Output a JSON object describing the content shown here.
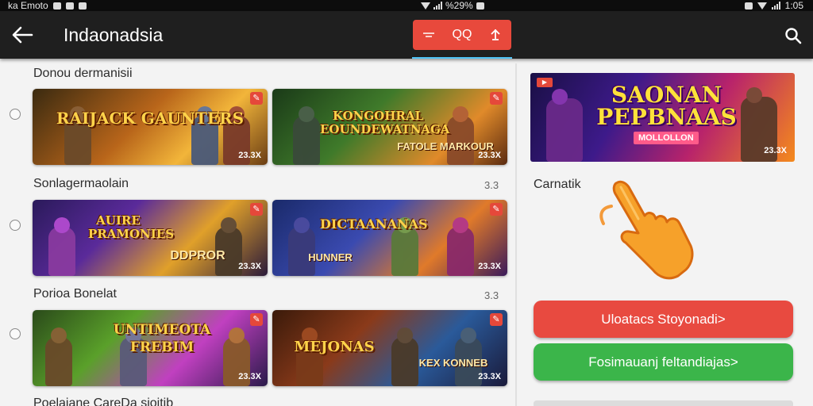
{
  "status_bar": {
    "left_text": "ka Emoto",
    "center_text": "%29%",
    "time": "1:05"
  },
  "app_bar": {
    "title": "Indaonadsia",
    "segment_label": "QQ"
  },
  "sections": [
    {
      "label": "Donou dermanisii",
      "count": "",
      "cards": [
        {
          "title": "RAIJACK GAUNTERS",
          "subtitle": "",
          "badge": "23.3X"
        },
        {
          "title": "KONGOHRAL EOUNDEWATNAGA",
          "subtitle": "FATOLE MARKOUR",
          "badge": "23.3X"
        }
      ]
    },
    {
      "label": "Sonlagermaolain",
      "count": "3.3",
      "cards": [
        {
          "title": "AUIRE PRAMONIES",
          "subtitle": "DDPROR",
          "badge": "23.3X"
        },
        {
          "title": "DICTAANANAS",
          "subtitle": "HUNNER",
          "badge": "23.3X"
        }
      ]
    },
    {
      "label": "Porioa Bonelat",
      "count": "3.3",
      "cards": [
        {
          "title": "UNTIMEOTA FREBIM",
          "subtitle": "",
          "badge": "23.3X"
        },
        {
          "title": "MEJONAS",
          "subtitle": "KEX KONNEB",
          "badge": "23.3X"
        }
      ]
    },
    {
      "label": "Poelaiane CareDa sioitib",
      "count": "",
      "cards": []
    }
  ],
  "promo": {
    "title": "SAONAN PEPBNAAS",
    "subtitle": "MOLLOLLON",
    "badge": "23.3X"
  },
  "side_label": "Carnatik",
  "buttons": {
    "primary": "Uloatacs Stoyonadi>",
    "secondary": "Fosimauanj feltandiajas>"
  },
  "colors": {
    "red": "#e84a40",
    "green": "#3bb54a",
    "appbar": "#1f1f1f",
    "accent_underline": "#4fc3f7"
  },
  "icons": [
    "back-arrow-icon",
    "minus-icon",
    "share-icon",
    "search-icon",
    "hand-pointer-icon",
    "radio-icon"
  ]
}
